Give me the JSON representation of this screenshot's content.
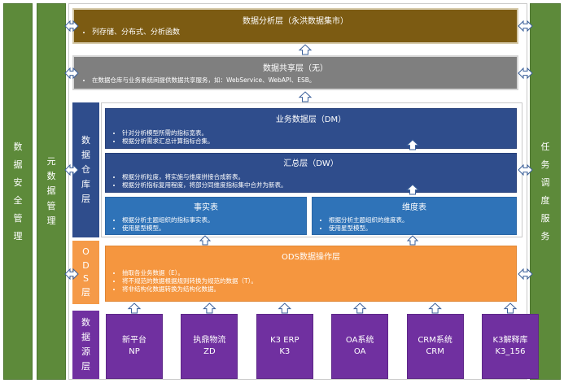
{
  "left_pillars": [
    {
      "label": "数据安全管理",
      "chars": [
        "数",
        "据",
        "安",
        "全",
        "管",
        "理"
      ]
    },
    {
      "label": "元数据管理",
      "chars": [
        "元",
        "数",
        "据",
        "管",
        "理"
      ]
    }
  ],
  "right_pillar": {
    "label": "任务调度服务",
    "chars": [
      "任",
      "务",
      "调",
      "度",
      "服",
      "务"
    ]
  },
  "layers": {
    "analysis": {
      "title": "数据分析层（永洪数据集市）",
      "bullets": [
        "列存储、分布式、分析函数"
      ]
    },
    "sharing": {
      "title": "数据共享层（无）",
      "bullets": [
        "在数据仓库与业务系统间提供数据共享服务，如：WebService、WebAPI、ESB。"
      ]
    },
    "warehouse_side": {
      "label": "数据仓库层",
      "chars": [
        "数",
        "据",
        "仓",
        "库",
        "层"
      ]
    },
    "dm": {
      "title": "业务数据层（DM）",
      "bullets": [
        "针对分析模型所需的指标宽表。",
        "根据分析需求汇总计算指标合集。"
      ]
    },
    "dw": {
      "title": "汇总层（DW）",
      "bullets": [
        "根据分析粒度，将实施与维度拼接合成新表。",
        "根据分析指标复用程度，将部分同维度指标集中合并为新表。"
      ]
    },
    "fact": {
      "title": "事实表",
      "bullets": [
        "根据分析主题组织的指标事实表。",
        "使用星型模型。"
      ]
    },
    "dim": {
      "title": "维度表",
      "bullets": [
        "根据分析主题组织的维度表。",
        "使用星型模型。"
      ]
    },
    "ods_side": {
      "label": "ODS层",
      "chars": [
        "O",
        "D",
        "S",
        "层"
      ]
    },
    "ods": {
      "title": "ODS数据操作层",
      "bullets": [
        "抽取各业务数据（E）。",
        "将不规范的数据根据规则转换为规范的数据（T）。",
        "将非结构化数据转换为结构化数据。"
      ]
    },
    "source_side": {
      "label": "数据源层",
      "chars": [
        "数",
        "据",
        "源",
        "层"
      ]
    },
    "sources": [
      {
        "line1": "新平台",
        "line2": "NP"
      },
      {
        "line1": "执鼎物流",
        "line2": "ZD"
      },
      {
        "line1": "K3 ERP",
        "line2": "K3"
      },
      {
        "line1": "OA系统",
        "line2": "OA"
      },
      {
        "line1": "CRM系统",
        "line2": "CRM"
      },
      {
        "line1": "K3解释库",
        "line2": "K3_156"
      }
    ]
  },
  "colors": {
    "pillar_green": "#5d8a3a",
    "analysis_gold": "#7c5b12",
    "sharing_grey": "#7f7f7f",
    "warehouse_navy": "#2f4d8c",
    "fact_dim_blue": "#2f73b8",
    "ods_orange": "#f5963f",
    "source_purple": "#7030a0"
  },
  "icons": [
    "up-arrow-icon",
    "double-arrow-icon"
  ]
}
